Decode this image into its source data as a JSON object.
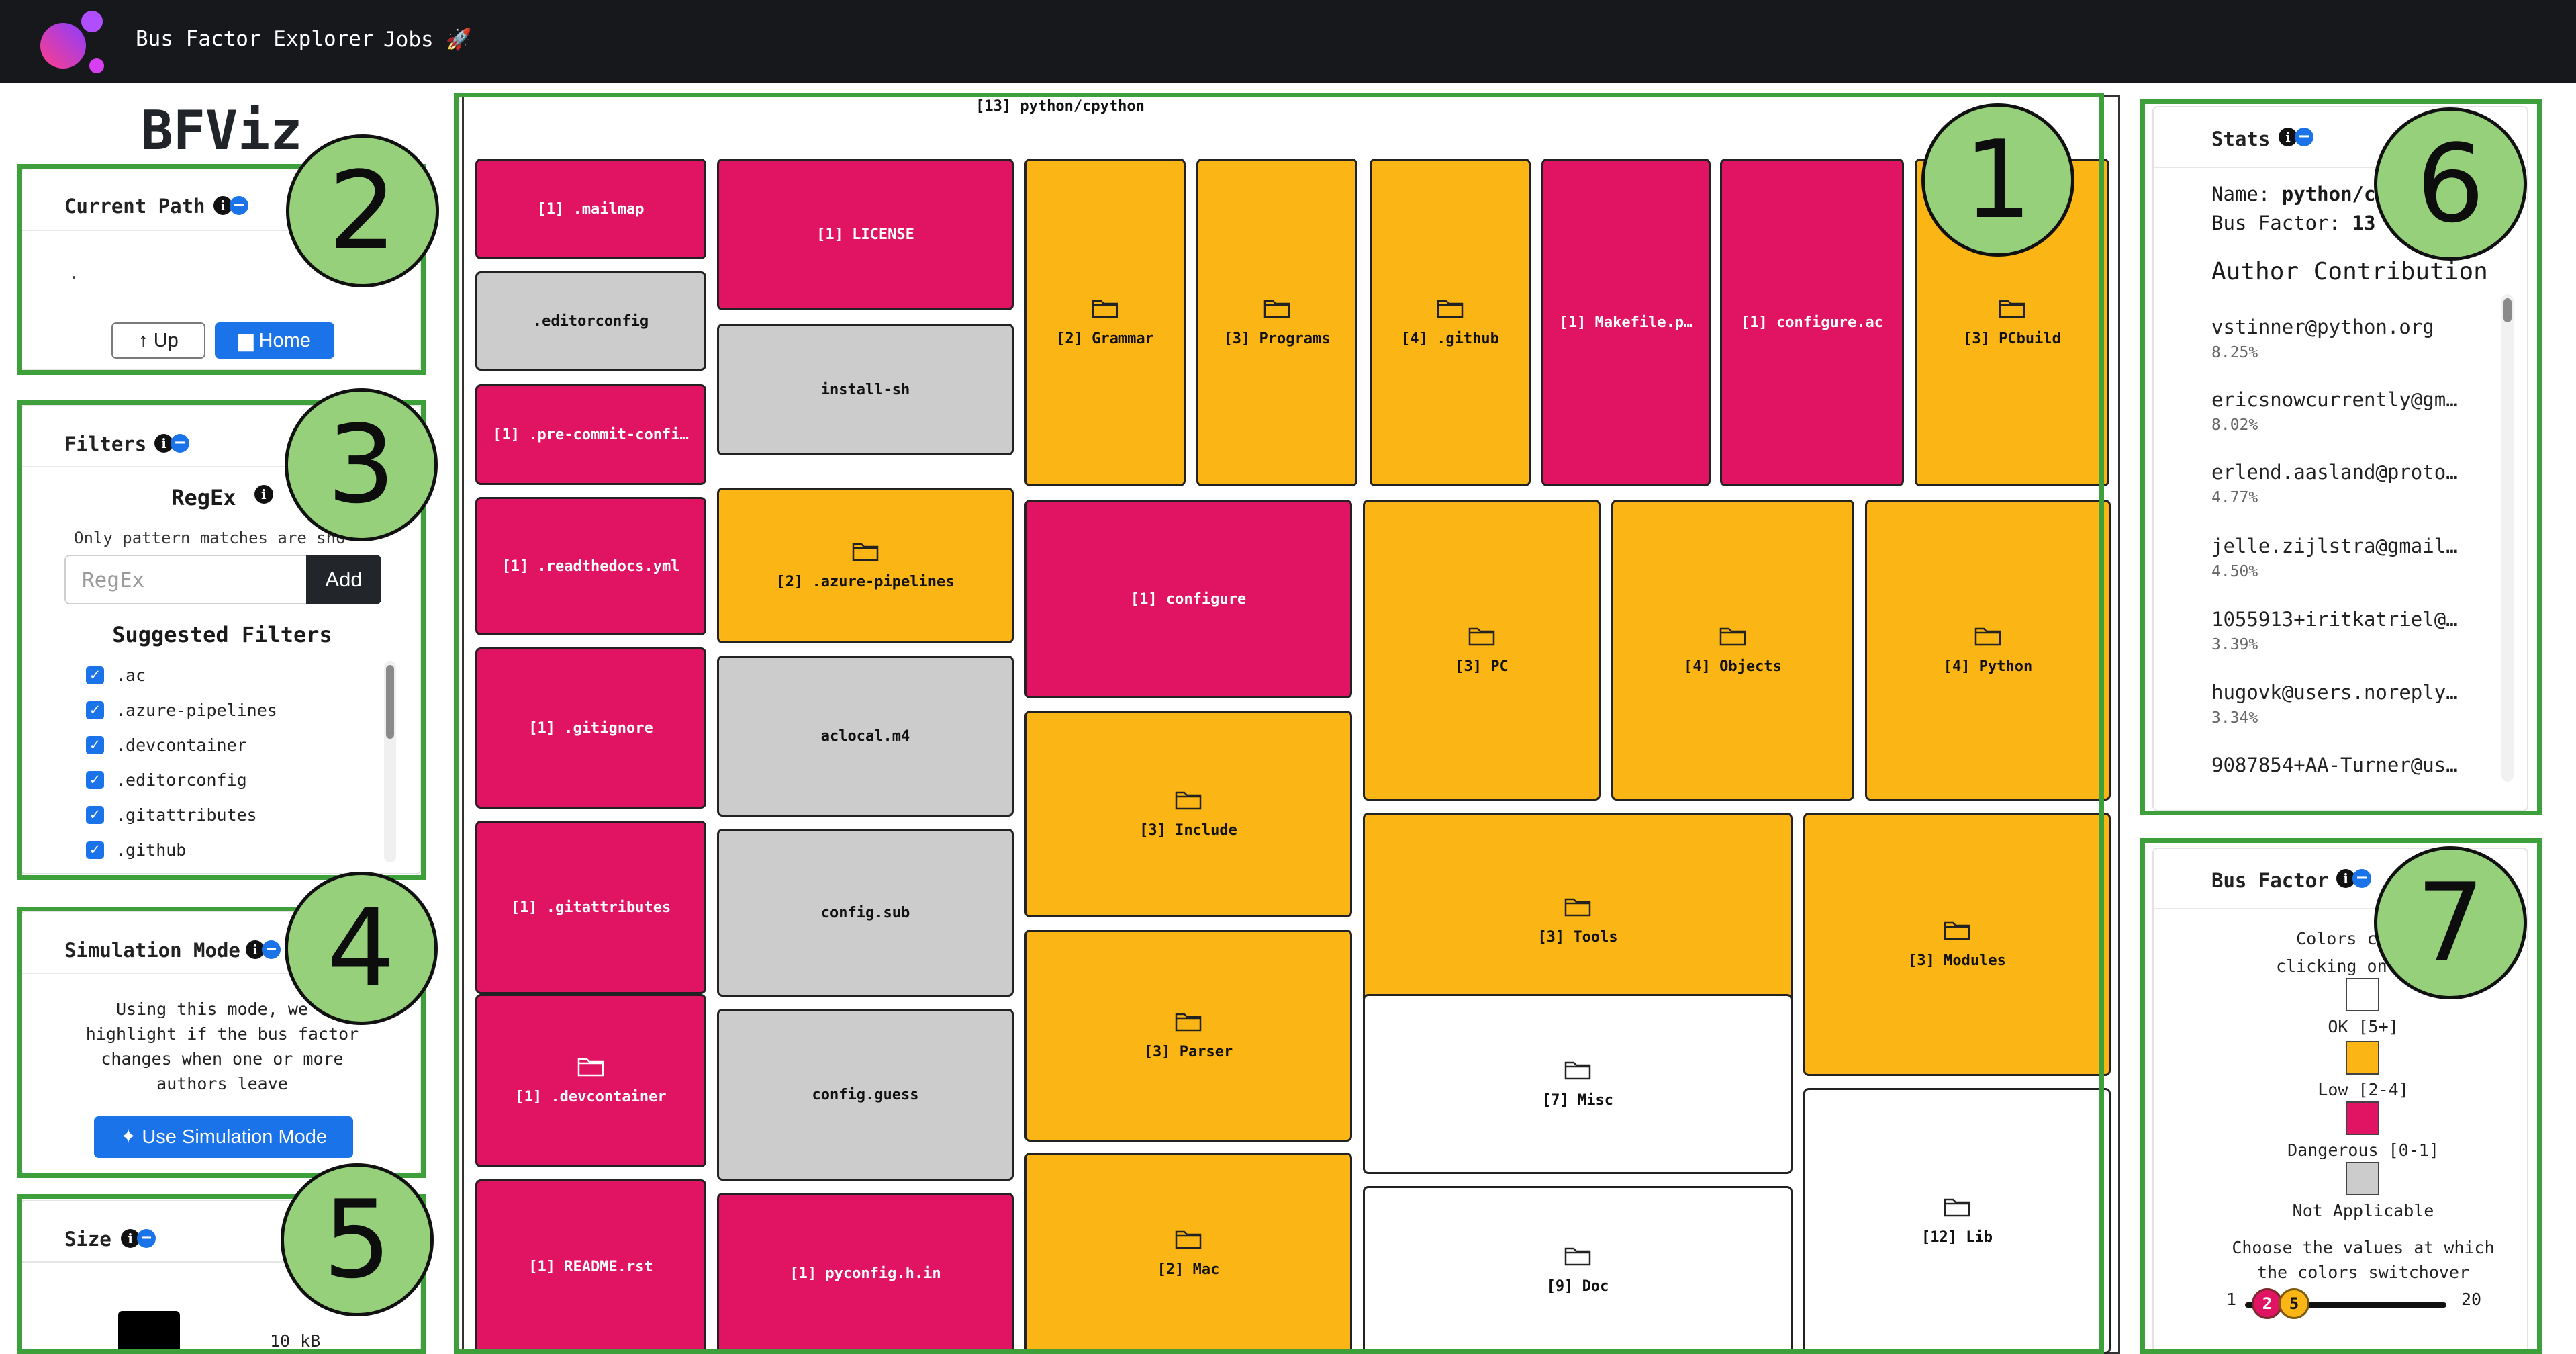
{
  "nav": {
    "title": "Bus Factor Explorer",
    "jobs_label": "Jobs 🚀"
  },
  "app_title": "BFViz",
  "current_path": {
    "title": "Current Path",
    "path": ".",
    "up_label": "Up",
    "home_label": "Home"
  },
  "filters": {
    "title": "Filters",
    "regex_label": "RegEx",
    "regex_help": "Only pattern matches are sho",
    "regex_placeholder": "RegEx",
    "add_label": "Add",
    "suggested_title": "Suggested Filters",
    "items": [
      ".ac",
      ".azure-pipelines",
      ".devcontainer",
      ".editorconfig",
      ".gitattributes",
      ".github"
    ]
  },
  "simulation": {
    "title": "Simulation Mode",
    "desc_lines": [
      "Using this mode, we c",
      "highlight if the bus factor",
      "changes when one or more",
      "authors leave"
    ],
    "button_label": "Use Simulation Mode"
  },
  "size": {
    "title": "Size",
    "value": "10 kB"
  },
  "treemap": {
    "title": "[13] python/cpython",
    "tiles": [
      {
        "label": "[1] .mailmap",
        "kind": "mag",
        "folder": false
      },
      {
        "label": ".editorconfig",
        "kind": "gry",
        "folder": false
      },
      {
        "label": "[1] .pre-commit-confi…",
        "kind": "mag",
        "folder": false
      },
      {
        "label": "[1] .readthedocs.yml",
        "kind": "mag",
        "folder": false
      },
      {
        "label": "[1] .gitignore",
        "kind": "mag",
        "folder": false
      },
      {
        "label": "[1] .gitattributes",
        "kind": "mag",
        "folder": false
      },
      {
        "label": "[1] .devcontainer",
        "kind": "mag",
        "folder": true
      },
      {
        "label": "[1] README.rst",
        "kind": "mag",
        "folder": false
      },
      {
        "label": "[1] LICENSE",
        "kind": "mag",
        "folder": false
      },
      {
        "label": "install-sh",
        "kind": "gry",
        "folder": false
      },
      {
        "label": "[2] .azure-pipelines",
        "kind": "org",
        "folder": true
      },
      {
        "label": "aclocal.m4",
        "kind": "gry",
        "folder": false
      },
      {
        "label": "config.sub",
        "kind": "gry",
        "folder": false
      },
      {
        "label": "config.guess",
        "kind": "gry",
        "folder": false
      },
      {
        "label": "[1] pyconfig.h.in",
        "kind": "mag",
        "folder": false
      },
      {
        "label": "[2] Grammar",
        "kind": "org",
        "folder": true
      },
      {
        "label": "[3] Programs",
        "kind": "org",
        "folder": true
      },
      {
        "label": "[4] .github",
        "kind": "org",
        "folder": true
      },
      {
        "label": "[1] Makefile.p…",
        "kind": "mag",
        "folder": false
      },
      {
        "label": "[1] configure.ac",
        "kind": "mag",
        "folder": false
      },
      {
        "label": "[3] PCbuild",
        "kind": "org",
        "folder": true
      },
      {
        "label": "[1] configure",
        "kind": "mag",
        "folder": false
      },
      {
        "label": "[3] PC",
        "kind": "org",
        "folder": true
      },
      {
        "label": "[4] Objects",
        "kind": "org",
        "folder": true
      },
      {
        "label": "[4] Python",
        "kind": "org",
        "folder": true
      },
      {
        "label": "[3] Include",
        "kind": "org",
        "folder": true
      },
      {
        "label": "[3] Tools",
        "kind": "org",
        "folder": true
      },
      {
        "label": "[3] Modules",
        "kind": "org",
        "folder": true
      },
      {
        "label": "[3] Parser",
        "kind": "org",
        "folder": true
      },
      {
        "label": "[7] Misc",
        "kind": "wht",
        "folder": true
      },
      {
        "label": "[2] Mac",
        "kind": "org",
        "folder": true
      },
      {
        "label": "[9] Doc",
        "kind": "wht",
        "folder": true
      },
      {
        "label": "[12] Lib",
        "kind": "wht",
        "folder": true
      }
    ]
  },
  "stats": {
    "title": "Stats",
    "name_label": "Name:",
    "name_value": "python/cp",
    "bf_label": "Bus Factor:",
    "bf_value": "13",
    "contrib_title": "Author Contribution",
    "authors": [
      {
        "email": "vstinner@python.org",
        "pct": "8.25%"
      },
      {
        "email": "ericsnowcurrently@gm…",
        "pct": "8.02%"
      },
      {
        "email": "erlend.aasland@proto…",
        "pct": "4.77%"
      },
      {
        "email": "jelle.zijlstra@gmail…",
        "pct": "4.50%"
      },
      {
        "email": "1055913+iritkatriel@…",
        "pct": "3.39%"
      },
      {
        "email": "hugovk@users.noreply…",
        "pct": "3.34%"
      },
      {
        "email": "9087854+AA-Turner@us…",
        "pct": ""
      }
    ]
  },
  "bus_factor": {
    "title": "Bus Factor",
    "desc_lines": [
      "Colors can be",
      "clicking on the s"
    ],
    "legend": [
      {
        "label": "OK [5+]",
        "color": "#ffffff"
      },
      {
        "label": "Low [2-4]",
        "color": "#fbb514"
      },
      {
        "label": "Dangerous [0-1]",
        "color": "#e01463"
      },
      {
        "label": "Not Applicable",
        "color": "#cccccc"
      }
    ],
    "switch_lines": [
      "Choose the values at which",
      "the colors switchover"
    ],
    "slider": {
      "min": "1",
      "max": "20",
      "low": "2",
      "high": "5"
    }
  },
  "annotations": [
    "1",
    "2",
    "3",
    "4",
    "5",
    "6",
    "7"
  ],
  "colors": {
    "accent": "#1a73e8",
    "danger": "#e01463",
    "low": "#fbb514",
    "na": "#cccccc",
    "annotation": "#3ea03a"
  }
}
